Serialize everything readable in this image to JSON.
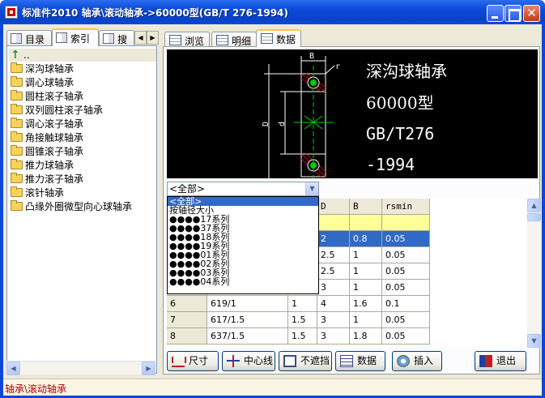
{
  "window": {
    "title": "标准件2010 轴承\\滚动轴承->60000型(GB/T 276-1994)"
  },
  "left_tabs": [
    {
      "label": "目录"
    },
    {
      "label": "索引"
    },
    {
      "label": "搜"
    }
  ],
  "tree": {
    "up": "..",
    "items": [
      "深沟球轴承",
      "调心球轴承",
      "圆柱滚子轴承",
      "双列圆柱滚子轴承",
      "调心滚子轴承",
      "角接触球轴承",
      "圆锥滚子轴承",
      "推力球轴承",
      "推力滚子轴承",
      "滚针轴承",
      "凸缘外圈微型向心球轴承"
    ]
  },
  "right_tabs": [
    {
      "label": "浏览"
    },
    {
      "label": "明细"
    },
    {
      "label": "数据"
    }
  ],
  "drawing": {
    "caption_lines": [
      "深沟球轴承",
      "60000型",
      "GB/T276",
      "-1994"
    ],
    "dim_B": "B",
    "dim_r": "r",
    "dim_D": "D",
    "dim_d": "d"
  },
  "combo": {
    "value": "<全部>"
  },
  "dropdown": {
    "items": [
      "<全部>",
      "按轴径大小",
      "●●●●17系列",
      "●●●●37系列",
      "●●●●18系列",
      "●●●●19系列",
      "●●●●01系列",
      "●●●●02系列",
      "●●●●03系列",
      "●●●●04系列"
    ]
  },
  "grid": {
    "headers": [
      "D",
      "B",
      "rsmin"
    ],
    "rows": [
      {
        "D": "",
        "B": "",
        "rsmin": ""
      },
      {
        "D": "2",
        "B": "0.8",
        "rsmin": "0.05"
      },
      {
        "D": "2.5",
        "B": "1",
        "rsmin": "0.05"
      },
      {
        "D": "2.5",
        "B": "1",
        "rsmin": "0.05"
      },
      {
        "D": "3",
        "B": "1",
        "rsmin": "0.05"
      }
    ],
    "full_rows": [
      {
        "idx": "6",
        "model": "619/1",
        "d": "1",
        "D": "4",
        "B": "1.6",
        "rsmin": "0.1"
      },
      {
        "idx": "7",
        "model": "617/1.5",
        "d": "1.5",
        "D": "3",
        "B": "1",
        "rsmin": "0.05"
      },
      {
        "idx": "8",
        "model": "637/1.5",
        "d": "1.5",
        "D": "3",
        "B": "1.8",
        "rsmin": "0.05"
      }
    ]
  },
  "buttons": {
    "size": "尺寸",
    "center": "中心线",
    "nomask": "不遮挡",
    "data": "数据",
    "insert": "插入",
    "exit": "退出"
  },
  "status": {
    "text": "轴承\\滚动轴承"
  }
}
